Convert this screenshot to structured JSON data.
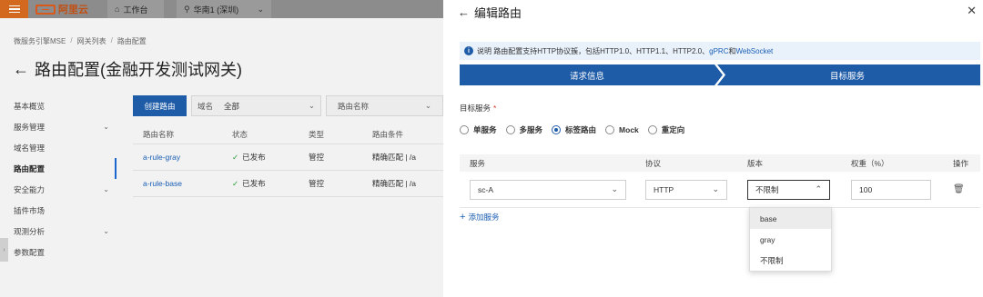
{
  "topbar": {
    "logo_text": "阿里云",
    "workbench_label": "工作台",
    "region_label": "华南1 (深圳)"
  },
  "breadcrumb": [
    "微服务引擎MSE",
    "网关列表",
    "路由配置"
  ],
  "page_title": "路由配置(金融开发测试网关)",
  "sidebar": {
    "items": [
      {
        "label": "基本概览",
        "has_children": false,
        "active": false
      },
      {
        "label": "服务管理",
        "has_children": true,
        "active": false
      },
      {
        "label": "域名管理",
        "has_children": false,
        "active": false
      },
      {
        "label": "路由配置",
        "has_children": false,
        "active": true
      },
      {
        "label": "安全能力",
        "has_children": true,
        "active": false
      },
      {
        "label": "插件市场",
        "has_children": false,
        "active": false
      },
      {
        "label": "观测分析",
        "has_children": true,
        "active": false
      },
      {
        "label": "参数配置",
        "has_children": false,
        "active": false
      }
    ]
  },
  "toolbar": {
    "create_label": "创建路由",
    "domain_filter_label": "域名",
    "domain_filter_value": "全部",
    "route_filter_label": "路由名称"
  },
  "route_table": {
    "headers": [
      "路由名称",
      "状态",
      "类型",
      "路由条件"
    ],
    "rows": [
      {
        "name": "a-rule-gray",
        "status": "已发布",
        "type": "管控",
        "condition": "精确匹配 | /a"
      },
      {
        "name": "a-rule-base",
        "status": "已发布",
        "type": "管控",
        "condition": "精确匹配 | /a"
      }
    ]
  },
  "drawer": {
    "title": "编辑路由",
    "notice": {
      "prefix": "说明 路由配置支持HTTP协议簇，包括HTTP1.0、HTTP1.1、HTTP2.0、",
      "link1": "gPRC",
      "middle": "和",
      "link2": "WebSocket"
    },
    "steps": [
      "请求信息",
      "目标服务"
    ],
    "target_label": "目标服务",
    "required_mark": "*",
    "radio_options": [
      {
        "label": "单服务",
        "checked": false
      },
      {
        "label": "多服务",
        "checked": false
      },
      {
        "label": "标签路由",
        "checked": true
      },
      {
        "label": "Mock",
        "checked": false
      },
      {
        "label": "重定向",
        "checked": false
      }
    ],
    "service_table": {
      "headers": [
        "服务",
        "协议",
        "版本",
        "权重（%）",
        "操作"
      ],
      "row": {
        "service": "sc-A",
        "protocol": "HTTP",
        "version": "不限制",
        "weight": "100"
      }
    },
    "add_service_label": "添加服务",
    "version_dropdown": [
      "base",
      "gray",
      "不限制"
    ]
  },
  "colors": {
    "primary": "#1f5ca8",
    "link": "#1a5fb4",
    "success": "#2a9d3a",
    "brand_orange": "#d9591b"
  }
}
